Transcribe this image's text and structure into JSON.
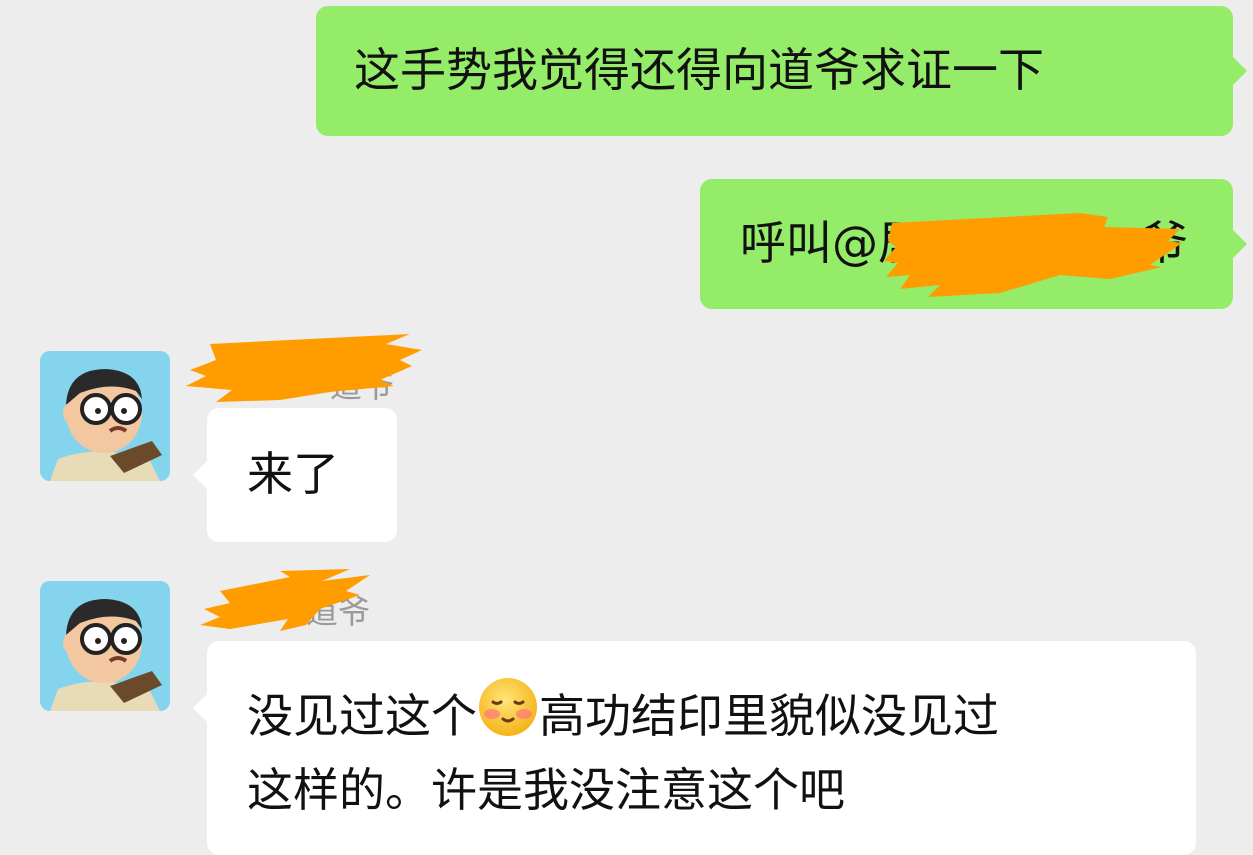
{
  "messages": [
    {
      "direction": "outgoing",
      "text": "这手势我觉得还得向道爷求证一下"
    },
    {
      "direction": "outgoing",
      "text_prefix": "呼叫@",
      "text_visible_fragment": "居",
      "text_suffix": "爷",
      "redacted": true
    },
    {
      "direction": "incoming",
      "sender_name_visible": "道爷",
      "text": "来了"
    },
    {
      "direction": "incoming",
      "sender_name_visible": "道爷",
      "text_line1_a": "没见过这个",
      "emoji": "blushing-face",
      "text_line1_b": "高功结印里貌似没见过",
      "text_line2": "这样的。许是我没注意这个吧"
    }
  ],
  "colors": {
    "background": "#ededed",
    "outgoing_bubble": "#95ec69",
    "incoming_bubble": "#ffffff",
    "redaction": "#ff9c00",
    "sender_name": "#9a9a9a"
  },
  "icons": {
    "avatar": "cartoon-boy-with-glasses-avatar",
    "emoji": "blushing-face-emoji"
  }
}
